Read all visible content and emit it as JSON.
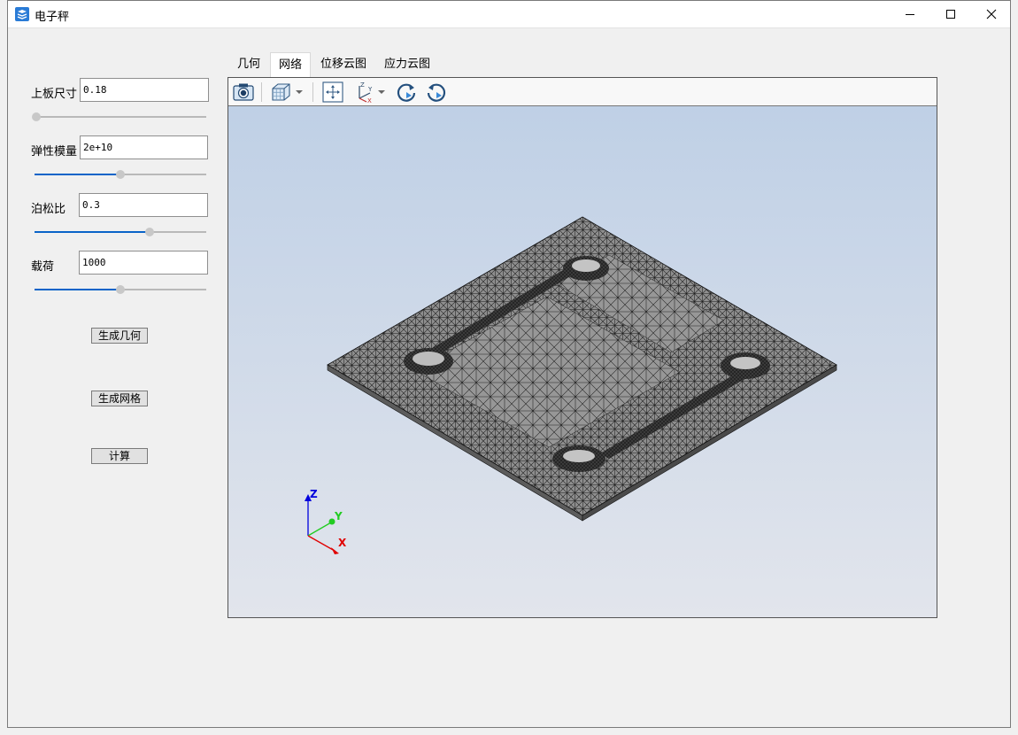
{
  "window": {
    "title": "电子秤"
  },
  "params": [
    {
      "label": "上板尺寸",
      "value": "0.18",
      "slider": 0.0
    },
    {
      "label": "弹性模量",
      "value": "2e+10",
      "slider": 0.5
    },
    {
      "label": "泊松比",
      "value": "0.3",
      "slider": 0.67
    },
    {
      "label": "载荷",
      "value": "1000",
      "slider": 0.5
    }
  ],
  "buttons": {
    "geometry": "生成几何",
    "mesh": "生成网格",
    "compute": "计算"
  },
  "tabs": [
    {
      "label": "几何",
      "active": false
    },
    {
      "label": "网络",
      "active": true
    },
    {
      "label": "位移云图",
      "active": false
    },
    {
      "label": "应力云图",
      "active": false
    }
  ],
  "toolbar": [
    "camera-icon",
    "view-cube-icon",
    "dropdown-arrow-icon",
    "fit-view-icon",
    "axes-icon",
    "dropdown-arrow-icon",
    "rotate-cw-icon",
    "rotate-ccw-icon"
  ],
  "axes": {
    "z": "Z",
    "y": "Y",
    "x": "X"
  },
  "colors": {
    "accent": "#0a64c8",
    "mesh_fill": "#8c8c8c",
    "axis_x": "#e00000",
    "axis_y": "#22cc22",
    "axis_z": "#0000dd"
  }
}
